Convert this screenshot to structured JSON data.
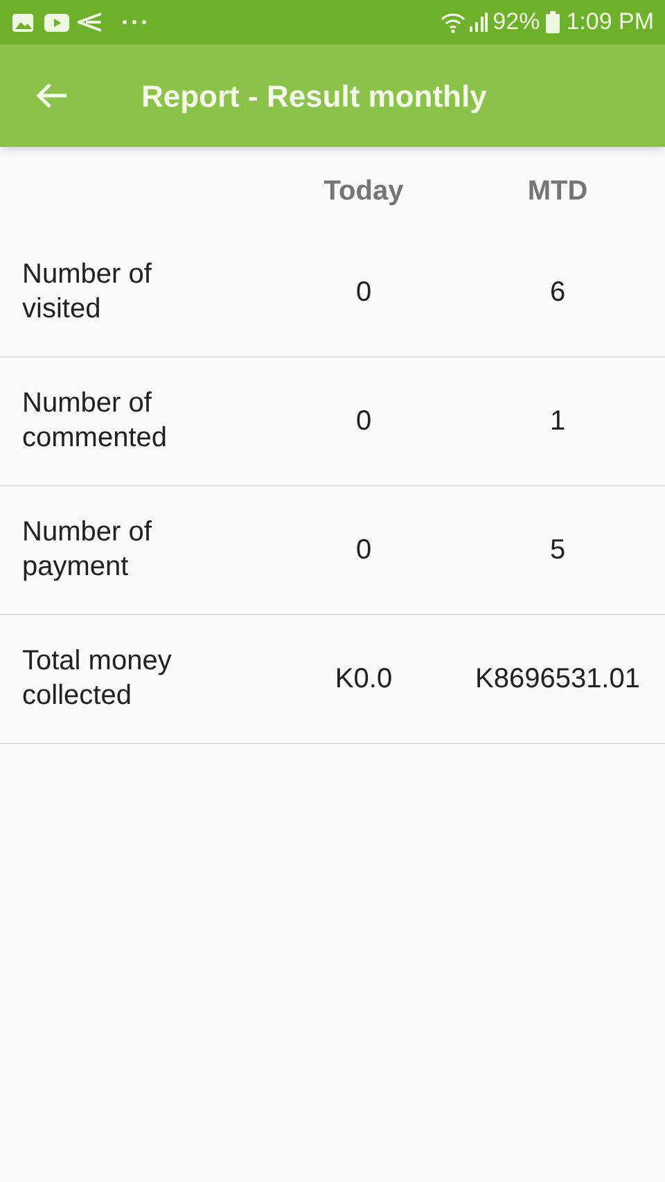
{
  "status_bar": {
    "battery": "92%",
    "time": "1:09 PM"
  },
  "app_bar": {
    "title": "Report - Result monthly"
  },
  "table": {
    "columns": [
      "Today",
      "MTD"
    ],
    "rows": [
      {
        "label": "Number of visited",
        "today": "0",
        "mtd": "6"
      },
      {
        "label": "Number of commented",
        "today": "0",
        "mtd": "1"
      },
      {
        "label": "Number of payment",
        "today": "0",
        "mtd": "5"
      },
      {
        "label": "Total money collected",
        "today": "K0.0",
        "mtd": "K8696531.01"
      }
    ]
  }
}
